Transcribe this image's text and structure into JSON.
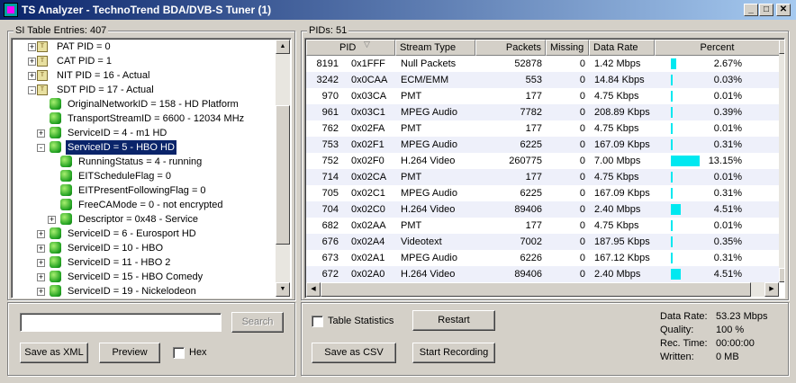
{
  "window": {
    "title": "TS Analyzer - TechnoTrend BDA/DVB-S Tuner (1)",
    "controls": {
      "minimize": "_",
      "maximize": "□",
      "close": "✕"
    }
  },
  "si_panel": {
    "label": "SI Table Entries: 407",
    "tree": [
      {
        "text": "PAT PID = 0",
        "level": 0,
        "icon": "table-icon",
        "expander": "+",
        "selected": false
      },
      {
        "text": "CAT PID = 1",
        "level": 0,
        "icon": "table-icon",
        "expander": "+",
        "selected": false
      },
      {
        "text": "NIT PID = 16 - Actual",
        "level": 0,
        "icon": "table-icon",
        "expander": "+",
        "selected": false
      },
      {
        "text": "SDT PID = 17 - Actual",
        "level": 0,
        "icon": "table-icon",
        "expander": "-",
        "selected": false
      },
      {
        "text": "OriginalNetworkID = 158 - HD Platform",
        "level": 1,
        "icon": "green-dot-icon",
        "expander": "",
        "selected": false
      },
      {
        "text": "TransportStreamID = 6600 - 12034 MHz",
        "level": 1,
        "icon": "green-dot-icon",
        "expander": "",
        "selected": false
      },
      {
        "text": "ServiceID = 4 - m1 HD",
        "level": 1,
        "icon": "green-dot-icon",
        "expander": "+",
        "selected": false
      },
      {
        "text": "ServiceID = 5 - HBO HD",
        "level": 1,
        "icon": "green-dot-icon",
        "expander": "-",
        "selected": true
      },
      {
        "text": "RunningStatus = 4 - running",
        "level": 2,
        "icon": "green-dot-icon",
        "expander": "",
        "selected": false
      },
      {
        "text": "EITScheduleFlag = 0",
        "level": 2,
        "icon": "green-dot-icon",
        "expander": "",
        "selected": false
      },
      {
        "text": "EITPresentFollowingFlag = 0",
        "level": 2,
        "icon": "green-dot-icon",
        "expander": "",
        "selected": false
      },
      {
        "text": "FreeCAMode = 0 - not encrypted",
        "level": 2,
        "icon": "green-dot-icon",
        "expander": "",
        "selected": false
      },
      {
        "text": "Descriptor = 0x48 - Service",
        "level": 2,
        "icon": "green-dot-icon",
        "expander": "+",
        "selected": false
      },
      {
        "text": "ServiceID = 6 - Eurosport HD",
        "level": 1,
        "icon": "green-dot-icon",
        "expander": "+",
        "selected": false
      },
      {
        "text": "ServiceID = 10 - HBO",
        "level": 1,
        "icon": "green-dot-icon",
        "expander": "+",
        "selected": false
      },
      {
        "text": "ServiceID = 11 - HBO 2",
        "level": 1,
        "icon": "green-dot-icon",
        "expander": "+",
        "selected": false
      },
      {
        "text": "ServiceID = 15 - HBO Comedy",
        "level": 1,
        "icon": "green-dot-icon",
        "expander": "+",
        "selected": false
      },
      {
        "text": "ServiceID = 19 - Nickelodeon",
        "level": 1,
        "icon": "green-dot-icon",
        "expander": "+",
        "selected": false
      }
    ],
    "search": {
      "value": "",
      "placeholder": "",
      "button": "Search"
    },
    "buttons": {
      "save_xml": "Save as XML",
      "preview": "Preview"
    },
    "hex_label": "Hex",
    "hex_checked": false
  },
  "pid_panel": {
    "label": "PIDs: 51",
    "columns": [
      "PID",
      "Stream Type",
      "Packets",
      "Missing",
      "Data Rate",
      "Percent"
    ],
    "sort_icon": "sort-desc-icon",
    "rows": [
      {
        "pid": "8191",
        "hex": "0x1FFF",
        "stream_type": "Null Packets",
        "packets": "52878",
        "missing": "0",
        "data_rate": "1.42 Mbps",
        "percent": "2.67%",
        "pct": 2.67
      },
      {
        "pid": "3242",
        "hex": "0x0CAA",
        "stream_type": "ECM/EMM",
        "packets": "553",
        "missing": "0",
        "data_rate": "14.84 Kbps",
        "percent": "0.03%",
        "pct": 0.03
      },
      {
        "pid": "970",
        "hex": "0x03CA",
        "stream_type": "PMT",
        "packets": "177",
        "missing": "0",
        "data_rate": "4.75 Kbps",
        "percent": "0.01%",
        "pct": 0.01
      },
      {
        "pid": "961",
        "hex": "0x03C1",
        "stream_type": "MPEG Audio",
        "packets": "7782",
        "missing": "0",
        "data_rate": "208.89 Kbps",
        "percent": "0.39%",
        "pct": 0.39
      },
      {
        "pid": "762",
        "hex": "0x02FA",
        "stream_type": "PMT",
        "packets": "177",
        "missing": "0",
        "data_rate": "4.75 Kbps",
        "percent": "0.01%",
        "pct": 0.01
      },
      {
        "pid": "753",
        "hex": "0x02F1",
        "stream_type": "MPEG Audio",
        "packets": "6225",
        "missing": "0",
        "data_rate": "167.09 Kbps",
        "percent": "0.31%",
        "pct": 0.31
      },
      {
        "pid": "752",
        "hex": "0x02F0",
        "stream_type": "H.264 Video",
        "packets": "260775",
        "missing": "0",
        "data_rate": "7.00 Mbps",
        "percent": "13.15%",
        "pct": 13.15
      },
      {
        "pid": "714",
        "hex": "0x02CA",
        "stream_type": "PMT",
        "packets": "177",
        "missing": "0",
        "data_rate": "4.75 Kbps",
        "percent": "0.01%",
        "pct": 0.01
      },
      {
        "pid": "705",
        "hex": "0x02C1",
        "stream_type": "MPEG Audio",
        "packets": "6225",
        "missing": "0",
        "data_rate": "167.09 Kbps",
        "percent": "0.31%",
        "pct": 0.31
      },
      {
        "pid": "704",
        "hex": "0x02C0",
        "stream_type": "H.264 Video",
        "packets": "89406",
        "missing": "0",
        "data_rate": "2.40 Mbps",
        "percent": "4.51%",
        "pct": 4.51
      },
      {
        "pid": "682",
        "hex": "0x02AA",
        "stream_type": "PMT",
        "packets": "177",
        "missing": "0",
        "data_rate": "4.75 Kbps",
        "percent": "0.01%",
        "pct": 0.01
      },
      {
        "pid": "676",
        "hex": "0x02A4",
        "stream_type": "Videotext",
        "packets": "7002",
        "missing": "0",
        "data_rate": "187.95 Kbps",
        "percent": "0.35%",
        "pct": 0.35
      },
      {
        "pid": "673",
        "hex": "0x02A1",
        "stream_type": "MPEG Audio",
        "packets": "6226",
        "missing": "0",
        "data_rate": "167.12 Kbps",
        "percent": "0.31%",
        "pct": 0.31
      },
      {
        "pid": "672",
        "hex": "0x02A0",
        "stream_type": "H.264 Video",
        "packets": "89406",
        "missing": "0",
        "data_rate": "2.40 Mbps",
        "percent": "4.51%",
        "pct": 4.51
      }
    ],
    "table_statistics_label": "Table Statistics",
    "table_statistics_checked": false,
    "buttons": {
      "restart": "Restart",
      "save_csv": "Save as CSV",
      "start_recording": "Start Recording"
    },
    "stats": [
      {
        "label": "Data Rate:",
        "value": "53.23 Mbps"
      },
      {
        "label": "Quality:",
        "value": "100 %"
      },
      {
        "label": "Rec. Time:",
        "value": "00:00:00"
      },
      {
        "label": "Written:",
        "value": "0 MB"
      }
    ]
  },
  "colors": {
    "selection": "#0a246a",
    "bar": "#00e8f0",
    "alt_row": "#eef0fa",
    "titlebar": "#0a246a"
  }
}
